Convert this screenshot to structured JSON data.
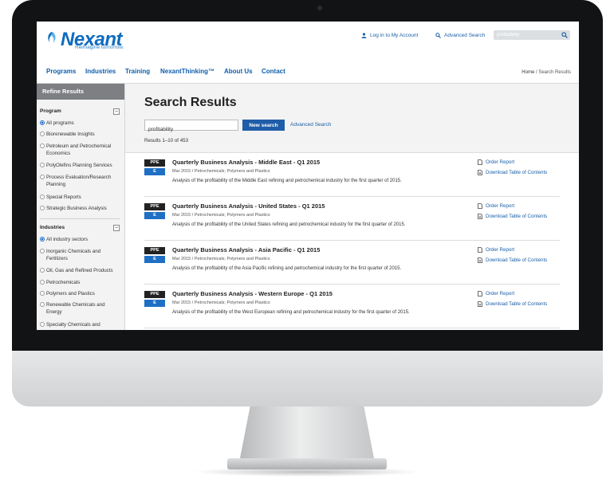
{
  "brand": {
    "name": "Nexant",
    "tagline": "Reimagine tomorrow.",
    "color": "#0e6bbf"
  },
  "header": {
    "login_label": "Log in to My Account",
    "advanced_search_label": "Advanced Search",
    "search_value": "profitability",
    "login_icon": "user-icon",
    "search_icon": "search-icon"
  },
  "nav": {
    "items": [
      "Programs",
      "Industries",
      "Training",
      "NexantThinking™",
      "About Us",
      "Contact"
    ]
  },
  "breadcrumb": {
    "home": "Home",
    "separator": " / ",
    "current": "Search Results"
  },
  "sidebar": {
    "title": "Refine Results",
    "program": {
      "title": "Program",
      "toggle": "−",
      "options": [
        {
          "label": "All programs",
          "selected": true
        },
        {
          "label": "Biorenewable Insights",
          "selected": false
        },
        {
          "label": "Petroleum and Petrochemical Economics",
          "selected": false
        },
        {
          "label": "PolyOlefins Planning Services",
          "selected": false
        },
        {
          "label": "Process Evaluation/Research Planning",
          "selected": false
        },
        {
          "label": "Special Reports",
          "selected": false
        },
        {
          "label": "Strategic Business Analysis",
          "selected": false
        }
      ]
    },
    "industries": {
      "title": "Industries",
      "toggle": "−",
      "options": [
        {
          "label": "All industry sectors",
          "selected": true
        },
        {
          "label": "Inorganic Chemicals and Fertilizers",
          "selected": false
        },
        {
          "label": "Oil, Gas and Refined Products",
          "selected": false
        },
        {
          "label": "Petrochemicals",
          "selected": false
        },
        {
          "label": "Polymers and Plastics",
          "selected": false
        },
        {
          "label": "Renewable Chemicals and Energy",
          "selected": false
        },
        {
          "label": "Specialty Chemicals and",
          "selected": false
        }
      ]
    }
  },
  "main": {
    "title": "Search Results",
    "search_value": "profitability",
    "new_search_label": "New search",
    "advanced_search_label": "Advanced Search",
    "results_count": "Results 1–10 of 453",
    "actions": {
      "order_label": "Order Report",
      "download_label": "Download Table of Contents"
    },
    "results": [
      {
        "badge_top": "PPE",
        "badge_bottom": "E",
        "title": "Quarterly Business Analysis - Middle East - Q1 2015",
        "meta": "Mar 2015 / Petrochemicals; Polymers and Plastics",
        "description": "Analysis of the profitability of the Middle East refining and petrochemical industry for the first quarter of 2015."
      },
      {
        "badge_top": "PPE",
        "badge_bottom": "E",
        "title": "Quarterly Business Analysis - United States - Q1 2015",
        "meta": "Mar 2015 / Petrochemicals; Polymers and Plastics",
        "description": "Analysis of the profitability of the United States refining and petrochemical industry for the first quarter of 2015."
      },
      {
        "badge_top": "PPE",
        "badge_bottom": "E",
        "title": "Quarterly Business Analysis - Asia Pacific - Q1 2015",
        "meta": "Mar 2015 / Petrochemicals; Polymers and Plastics",
        "description": "Analysis of the profitability of the Asia Pacific refining and petrochemical industry for the first quarter of 2015."
      },
      {
        "badge_top": "PPE",
        "badge_bottom": "E",
        "title": "Quarterly Business Analysis - Western Europe - Q1 2015",
        "meta": "Mar 2015 / Petrochemicals; Polymers and Plastics",
        "description": "Analysis of the profitability of the West European refining and petrochemical industry for the first quarter of 2015."
      }
    ]
  }
}
